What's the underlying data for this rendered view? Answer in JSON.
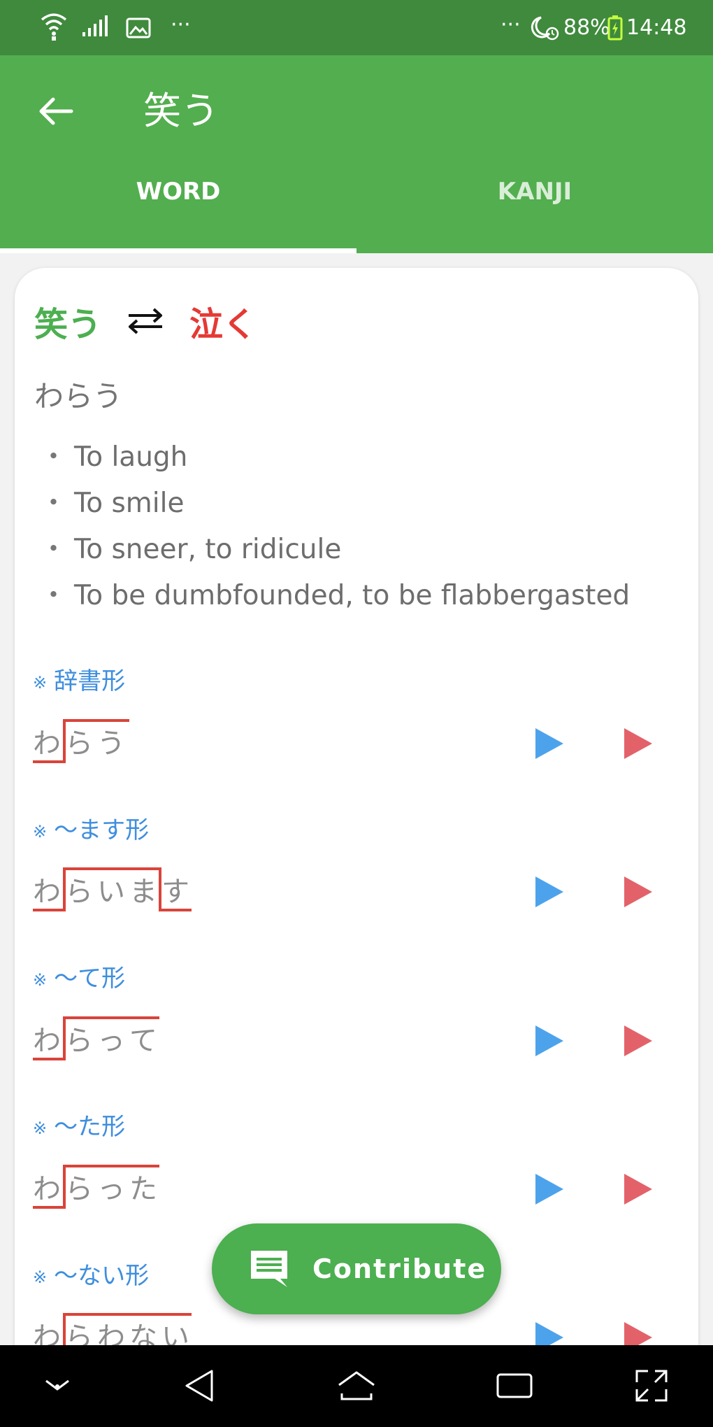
{
  "status_bar": {
    "left_more": "···",
    "right_more": "···",
    "battery": "88%",
    "time": "14:48"
  },
  "app_bar": {
    "title": "笑う",
    "tabs": [
      {
        "label": "WORD",
        "selected": true
      },
      {
        "label": "KANJI",
        "selected": false
      }
    ]
  },
  "word": {
    "main": "笑う",
    "antonym": "泣く",
    "reading": "わらう",
    "meanings": [
      "To laugh",
      "To smile",
      "To sneer, to ridicule",
      "To be dumbfounded, to be flabbergasted"
    ]
  },
  "forms": [
    {
      "label": "辞書形",
      "kana": [
        "わ",
        "ら",
        "う"
      ]
    },
    {
      "label": "〜ます形",
      "kana": [
        "わ",
        "ら",
        "い",
        "ま",
        "す"
      ]
    },
    {
      "label": "〜て形",
      "kana": [
        "わ",
        "ら",
        "っ",
        "て"
      ]
    },
    {
      "label": "〜た形",
      "kana": [
        "わ",
        "ら",
        "っ",
        "た"
      ]
    },
    {
      "label": "〜ない形",
      "kana": [
        "わ",
        "ら",
        "わ",
        "な",
        "い"
      ]
    }
  ],
  "form_mark": "※",
  "fab": {
    "label": "Contribute",
    "icon": "comment-icon"
  },
  "colors": {
    "status_bar": "#3f8a3c",
    "app_bar": "#52ae4e",
    "word": "#4caf50",
    "antonym": "#e53935",
    "form_label": "#3e8ede",
    "pitch_line": "#d9443a",
    "play_blue": "#4da3eb",
    "play_red": "#e3626a"
  }
}
